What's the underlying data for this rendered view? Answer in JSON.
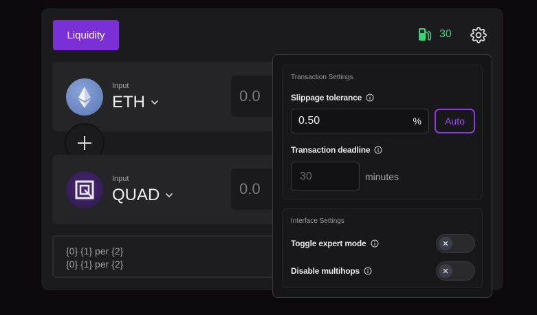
{
  "header": {
    "liquidity_label": "Liquidity",
    "gas_icon": "fuel-pump-icon",
    "gas_value": "30",
    "settings_icon": "gear-icon"
  },
  "inputs": [
    {
      "label": "Input",
      "token": "ETH",
      "amount_placeholder": "0.0",
      "logo": "ethereum-logo"
    },
    {
      "label": "Input",
      "token": "QUAD",
      "amount_placeholder": "0.0",
      "logo": "quad-logo"
    }
  ],
  "add_icon": "plus-icon",
  "rates": [
    "{0} {1} per {2}",
    "{0} {1} per {2}"
  ],
  "settings": {
    "transaction_title": "Transaction Settings",
    "slippage_label": "Slippage tolerance",
    "slippage_value": "0.50",
    "slippage_unit": "%",
    "auto_label": "Auto",
    "deadline_label": "Transaction deadline",
    "deadline_placeholder": "30",
    "deadline_unit": "minutes",
    "interface_title": "Interface Settings",
    "expert_mode_label": "Toggle expert mode",
    "multihops_label": "Disable multihops"
  },
  "colors": {
    "accent": "#7b2fd6",
    "gas_green": "#37d47a",
    "auto_purple": "#9b52f0"
  }
}
